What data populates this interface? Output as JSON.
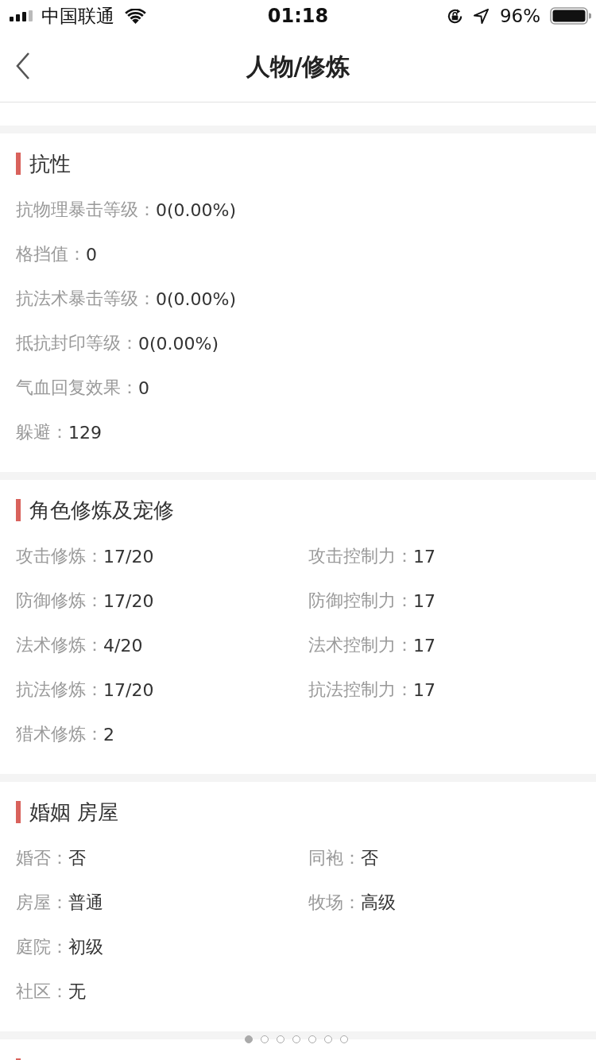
{
  "status_bar": {
    "carrier": "中国联通",
    "time": "01:18",
    "battery": "96%"
  },
  "nav_bar": {
    "title": "人物/修炼"
  },
  "sections": [
    {
      "title": "抗性",
      "rows": [
        [
          {
            "label": "抗物理暴击等级：",
            "value": "0(0.00%)"
          }
        ],
        [
          {
            "label": "格挡值：",
            "value": "0"
          }
        ],
        [
          {
            "label": "抗法术暴击等级：",
            "value": "0(0.00%)"
          }
        ],
        [
          {
            "label": "抵抗封印等级：",
            "value": "0(0.00%)"
          }
        ],
        [
          {
            "label": "气血回复效果：",
            "value": "0"
          }
        ],
        [
          {
            "label": "躲避：",
            "value": "129"
          }
        ]
      ]
    },
    {
      "title": "角色修炼及宠修",
      "rows": [
        [
          {
            "label": "攻击修炼：",
            "value": "17/20"
          },
          {
            "label": "攻击控制力：",
            "value": "17"
          }
        ],
        [
          {
            "label": "防御修炼：",
            "value": "17/20"
          },
          {
            "label": "防御控制力：",
            "value": "17"
          }
        ],
        [
          {
            "label": "法术修炼：",
            "value": "4/20"
          },
          {
            "label": "法术控制力：",
            "value": "17"
          }
        ],
        [
          {
            "label": "抗法修炼：",
            "value": "17/20"
          },
          {
            "label": "抗法控制力：",
            "value": "17"
          }
        ],
        [
          {
            "label": "猎术修炼：",
            "value": "2"
          }
        ]
      ]
    },
    {
      "title": "婚姻 房屋",
      "rows": [
        [
          {
            "label": "婚否：",
            "value": "否"
          },
          {
            "label": "同袍：",
            "value": "否"
          }
        ],
        [
          {
            "label": "房屋：",
            "value": "普通"
          },
          {
            "label": "牧场：",
            "value": "高级"
          }
        ],
        [
          {
            "label": "庭院：",
            "value": "初级"
          }
        ],
        [
          {
            "label": "社区：",
            "value": "无"
          }
        ]
      ]
    }
  ],
  "page_dots": [
    {
      "selected": true
    },
    {
      "selected": false
    },
    {
      "selected": false
    },
    {
      "selected": false
    },
    {
      "selected": false
    },
    {
      "selected": false
    },
    {
      "selected": false
    }
  ]
}
